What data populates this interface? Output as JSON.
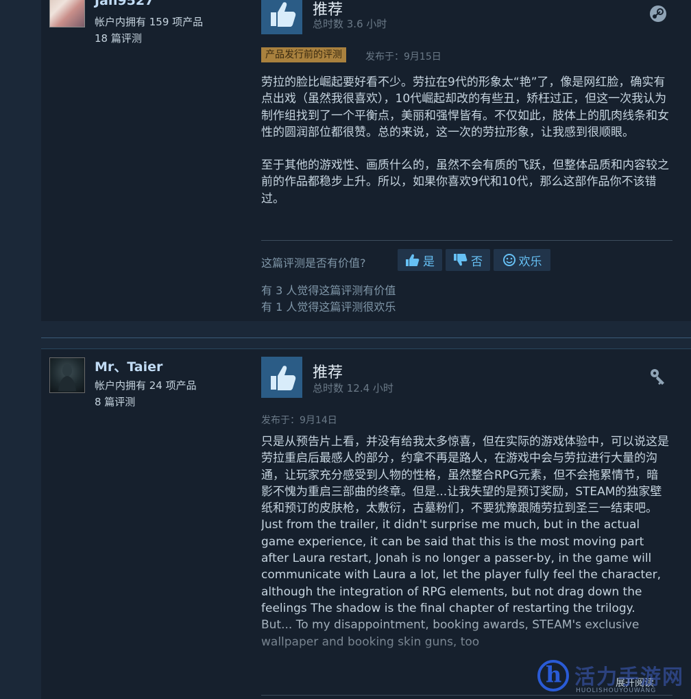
{
  "review1": {
    "username": "Jan9527",
    "products_owned": "帐户内拥有 159 项产品",
    "review_count": "18 篇评测",
    "recommendation": "推荐",
    "hours": "总时数 3.6 小时",
    "pre_release_tag": "产品发行前的评测",
    "posted": "发布于：9月15日",
    "body": [
      "劳拉的脸比崛起要好看不少。劳拉在9代的形象太“艳”了，像是网红脸，确实有点出戏（虽然我很喜欢），10代崛起却改的有些丑，矫枉过正，但这一次我认为制作组找到了一个平衡点，美丽和强悍皆有。不仅如此，肢体上的肌肉线条和女性的圆润部位都很赞。总的来说，这一次的劳拉形象，让我感到很顺眼。",
      "至于其他的游戏性、画质什么的，虽然不会有质的飞跃，但整体品质和内容较之前的作品都稳步上升。所以，如果你喜欢9代和10代，那么这部作品你不该错过。"
    ],
    "helpful_question": "这篇评测是否有价值?",
    "yes_label": "是",
    "no_label": "否",
    "funny_label": "欢乐",
    "helpful_count": "有 3 人觉得这篇评测有价值",
    "funny_count": "有 1 人觉得这篇评测很欢乐",
    "corner_icon": "steam-icon"
  },
  "review2": {
    "username": "Mr、Taier",
    "products_owned": "帐户内拥有 24 项产品",
    "review_count": "8 篇评测",
    "recommendation": "推荐",
    "hours": "总时数 12.4 小时",
    "posted": "发布于：9月14日",
    "body": "只是从预告片上看，并没有给我太多惊喜，但在实际的游戏体验中，可以说这是劳拉重启后最感人的部分，约拿不再是路人，在游戏中会与劳拉进行大量的沟通，让玩家充分感受到人物的性格，虽然整合RPG元素，但不会拖累情节，暗影不愧为重启三部曲的终章。但是...让我失望的是预订奖励，STEAM的独家壁纸和预订的皮肤枪，太敷衍，古墓粉们，不要犹豫跟随劳拉到圣三一结束吧。\nJust from the trailer, it didn't surprise me much, but in the actual game experience, it can be said that this is the most moving part after Laura restart, Jonah is no longer a passer-by, in the game will communicate with Laura a lot, let the player fully feel the character, although the integration of RPG elements, but not drag down the feelings The shadow is the final chapter of restarting the trilogy. But... To my disappointment, booking awards, STEAM's exclusive wallpaper and booking skin guns, too",
    "expand_label": "展开阅读",
    "corner_icon": "key-icon"
  },
  "watermark": {
    "text": "活力手游网",
    "sub": "HUOLISHOUYOUWANG"
  }
}
